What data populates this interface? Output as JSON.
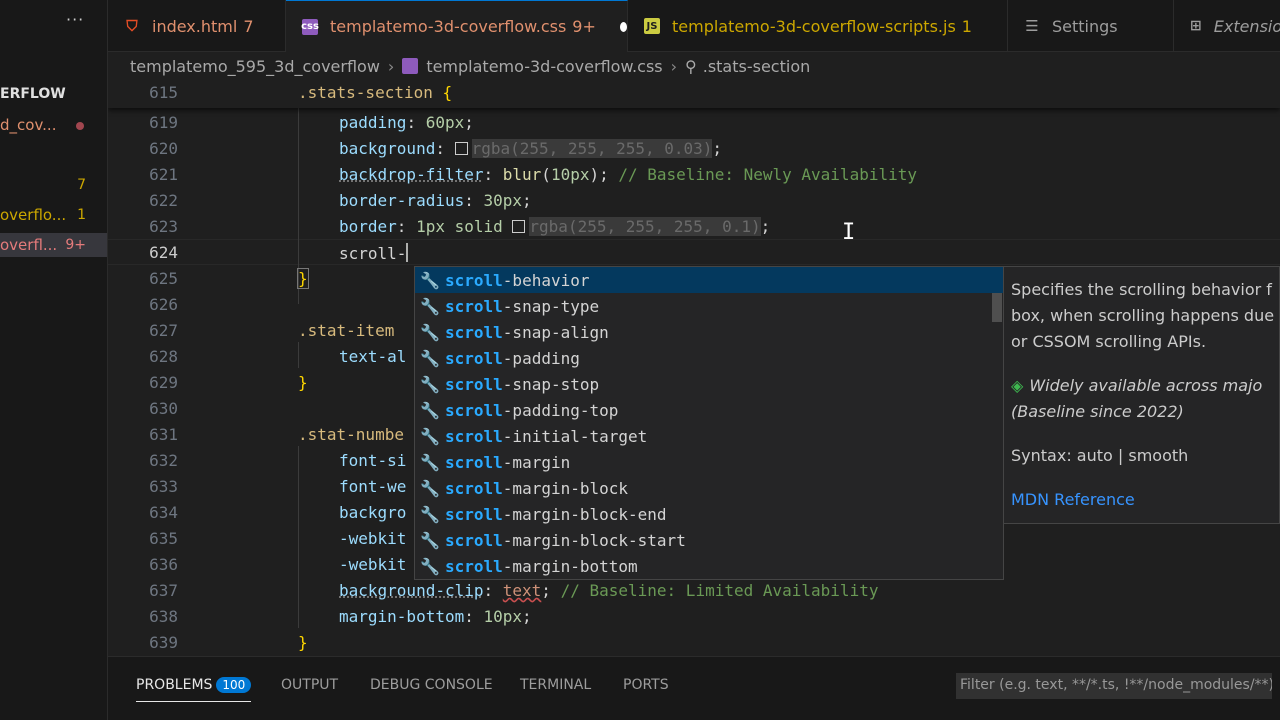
{
  "sidebar": {
    "more": "···",
    "folder": "ERFLOW",
    "files": [
      {
        "name": "d_cov...",
        "badge": ""
      },
      {
        "name": "",
        "badge": "7"
      },
      {
        "name": "overflo...",
        "badge": "1"
      },
      {
        "name": "overfl...",
        "badge": "9+"
      }
    ]
  },
  "tabs": [
    {
      "icon": "html5-icon",
      "name": "index.html",
      "count": "7"
    },
    {
      "icon": "css-icon",
      "name": "templatemo-3d-coverflow.css",
      "count": "9+"
    },
    {
      "icon": "js-icon",
      "name": "templatemo-3d-coverflow-scripts.js",
      "count": "1"
    },
    {
      "icon": "settings-icon",
      "name": "Settings",
      "count": ""
    },
    {
      "icon": "extensions-icon",
      "name": "Extensio",
      "count": ""
    }
  ],
  "breadcrumb": {
    "folder": "templatemo_595_3d_coverflow",
    "file": "templatemo-3d-coverflow.css",
    "symbol": ".stats-section"
  },
  "editor": {
    "sticky": {
      "line": "615",
      "selector": ".stats-section",
      "brace": "{"
    },
    "lines": [
      {
        "n": "619",
        "prop": "padding",
        "value": "60px",
        "end": ";"
      },
      {
        "n": "620",
        "prop": "background",
        "rgba": "rgba(255, 255, 255, 0.03)",
        "end": ";"
      },
      {
        "n": "621",
        "prop": "backdrop-filter",
        "fn": "blur",
        "arg": "10px",
        "comment": "// Baseline: Newly Availability"
      },
      {
        "n": "622",
        "prop": "border-radius",
        "value": "30px",
        "end": ";"
      },
      {
        "n": "623",
        "prop": "border",
        "value": "1px solid",
        "rgba": "rgba(255, 255, 255, 0.1)",
        "end": ";"
      },
      {
        "n": "624",
        "typed": "scroll-"
      },
      {
        "n": "625",
        "brace": "}"
      },
      {
        "n": "626"
      },
      {
        "n": "627",
        "selector": ".stat-item"
      },
      {
        "n": "628",
        "partial": "text-al"
      },
      {
        "n": "629",
        "brace": "}"
      },
      {
        "n": "630"
      },
      {
        "n": "631",
        "selector": ".stat-numbe"
      },
      {
        "n": "632",
        "partial": "font-si"
      },
      {
        "n": "633",
        "partial": "font-we"
      },
      {
        "n": "634",
        "partial": "backgro"
      },
      {
        "n": "635",
        "partial": "-webkit"
      },
      {
        "n": "636",
        "partial": "-webkit"
      },
      {
        "n": "637",
        "prop": "background-clip",
        "value": "text",
        "end": ";",
        "comment": "// Baseline: Limited Availability"
      },
      {
        "n": "638",
        "prop": "margin-bottom",
        "value": "10px",
        "end": ";"
      },
      {
        "n": "639",
        "brace": "}"
      }
    ]
  },
  "suggest": {
    "match": "scroll",
    "items": [
      "-behavior",
      "-snap-type",
      "-snap-align",
      "-padding",
      "-snap-stop",
      "-padding-top",
      "-initial-target",
      "-margin",
      "-margin-block",
      "-margin-block-end",
      "-margin-block-start",
      "-margin-bottom"
    ],
    "details": {
      "description": "Specifies the scrolling behavior f box, when scrolling happens due or CSSOM scrolling APIs.",
      "baseline": "Widely available across majo (Baseline since 2022)",
      "syntax": "Syntax: auto | smooth",
      "link": "MDN Reference"
    }
  },
  "panel": {
    "tabs": [
      "PROBLEMS",
      "OUTPUT",
      "DEBUG CONSOLE",
      "TERMINAL",
      "PORTS"
    ],
    "problems_count": "100",
    "filter_placeholder": "Filter (e.g. text, **/*.ts, !**/node_modules/**)"
  }
}
